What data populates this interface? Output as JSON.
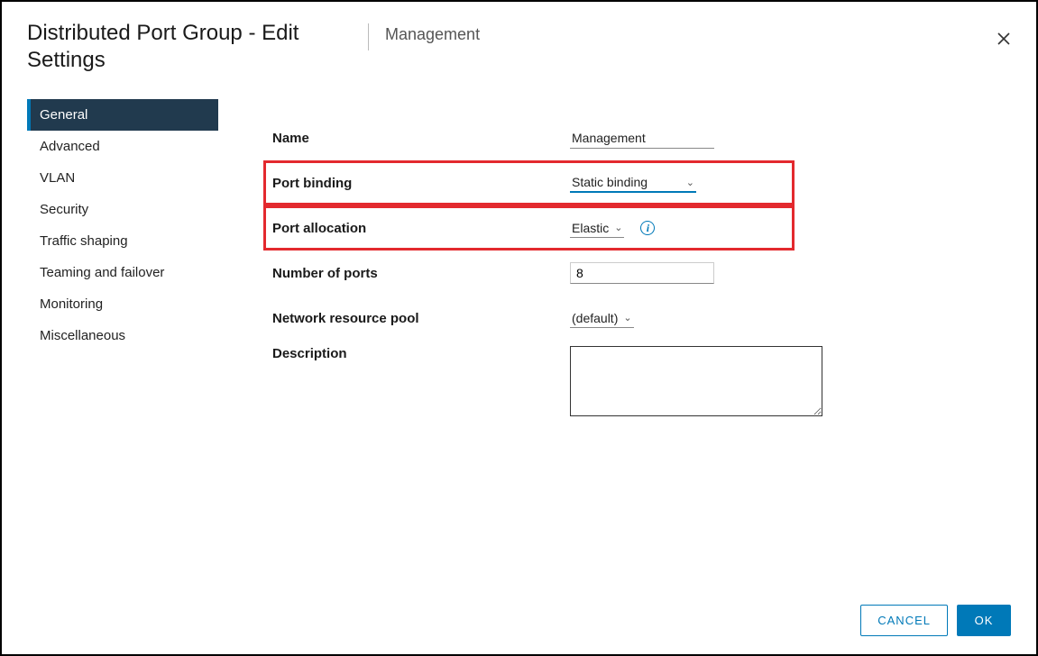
{
  "header": {
    "title": "Distributed Port Group - Edit Settings",
    "subtitle": "Management"
  },
  "sidebar": {
    "items": [
      {
        "label": "General",
        "active": true
      },
      {
        "label": "Advanced",
        "active": false
      },
      {
        "label": "VLAN",
        "active": false
      },
      {
        "label": "Security",
        "active": false
      },
      {
        "label": "Traffic shaping",
        "active": false
      },
      {
        "label": "Teaming and failover",
        "active": false
      },
      {
        "label": "Monitoring",
        "active": false
      },
      {
        "label": "Miscellaneous",
        "active": false
      }
    ]
  },
  "form": {
    "name": {
      "label": "Name",
      "value": "Management"
    },
    "port_binding": {
      "label": "Port binding",
      "value": "Static binding"
    },
    "port_allocation": {
      "label": "Port allocation",
      "value": "Elastic"
    },
    "number_of_ports": {
      "label": "Number of ports",
      "value": "8"
    },
    "network_resource_pool": {
      "label": "Network resource pool",
      "value": "(default)"
    },
    "description": {
      "label": "Description",
      "value": ""
    }
  },
  "footer": {
    "cancel": "CANCEL",
    "ok": "OK"
  }
}
